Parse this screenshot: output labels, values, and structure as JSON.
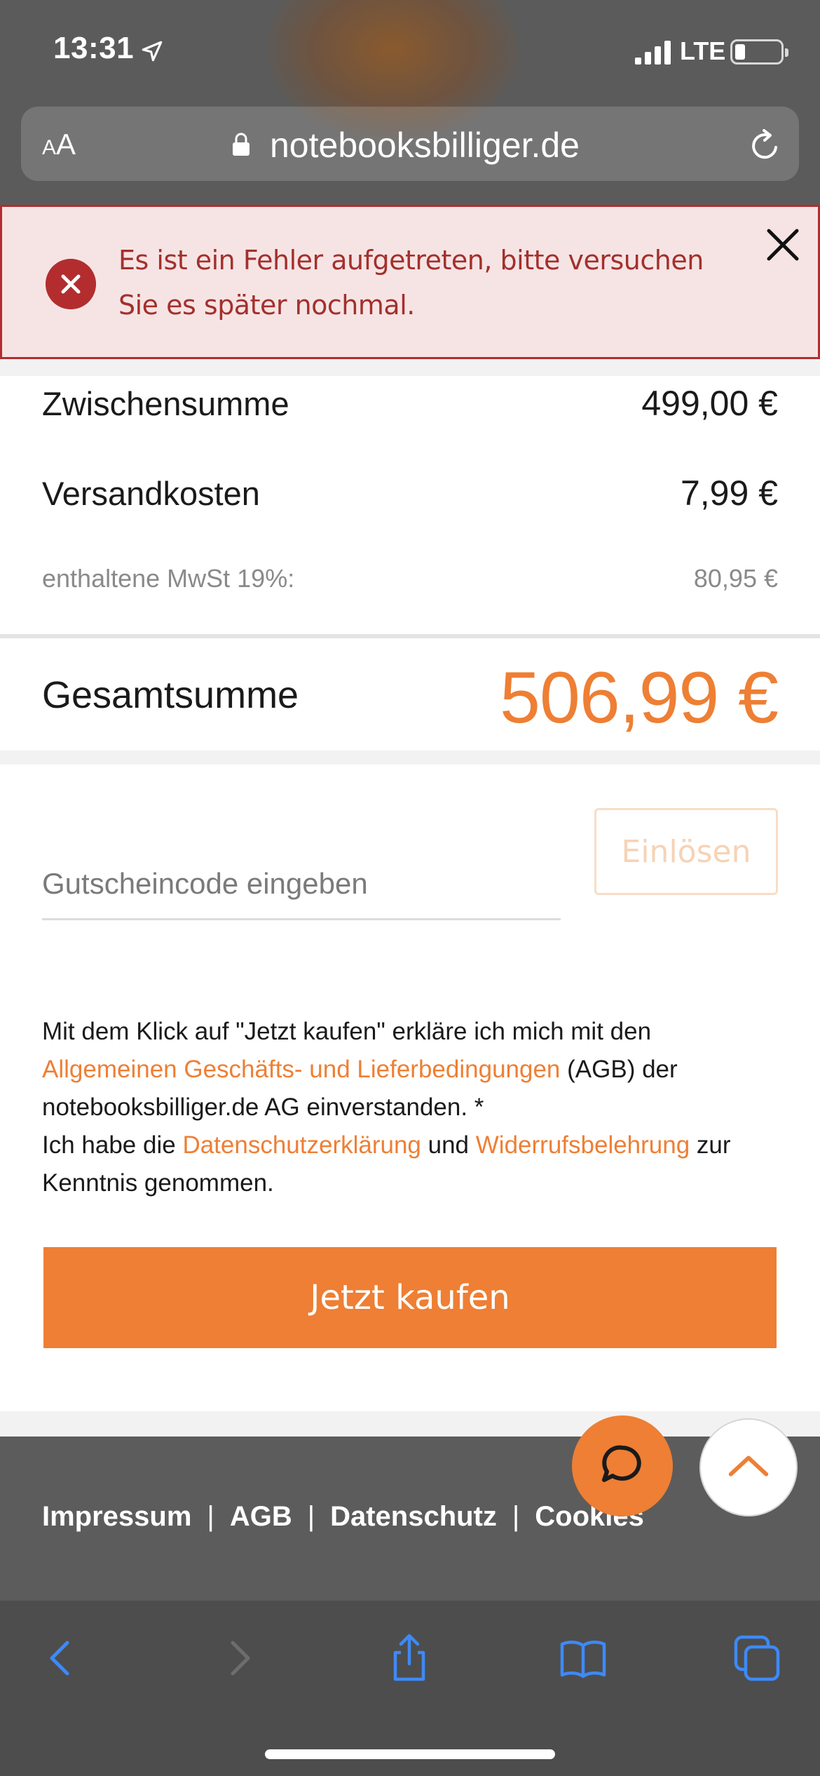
{
  "status_bar": {
    "time": "13:31",
    "network": "LTE",
    "location_icon": "location-arrow-icon",
    "signal_icon": "signal-bars-icon",
    "battery_icon": "battery-low-icon"
  },
  "browser": {
    "text_size_small": "A",
    "text_size_large": "A",
    "url": "notebooksbilliger.de",
    "lock_icon": "lock-icon",
    "reload_icon": "reload-icon"
  },
  "error_banner": {
    "message": "Es ist ein Fehler aufgetreten, bitte versuchen Sie es später nochmal.",
    "icon": "error-circle-x-icon",
    "close_icon": "close-icon"
  },
  "summary": {
    "subtotal_label": "Zwischensumme",
    "subtotal_value": "499,00 €",
    "shipping_label": "Versandkosten",
    "shipping_value": "7,99 €",
    "vat_label": "enthaltene MwSt 19%:",
    "vat_value": "80,95 €",
    "total_label": "Gesamtsumme",
    "total_value": "506,99 €"
  },
  "coupon": {
    "placeholder": "Gutscheincode eingeben",
    "redeem_label": "Einlösen"
  },
  "legal": {
    "part1": "Mit dem Klick auf \"Jetzt kaufen\" erkläre ich mich mit den",
    "agb_link": "Allgemeinen Geschäfts- und Lieferbedingungen",
    "part2": " (AGB) der notebooksbilliger.de AG einverstanden. *",
    "part3": "Ich habe die ",
    "privacy_link": "Datenschutzerklärung",
    "part4": " und ",
    "withdrawal_link": "Widerrufsbelehrung",
    "part5": " zur Kenntnis genommen."
  },
  "buy_button": {
    "label": "Jetzt kaufen"
  },
  "footer": {
    "links": [
      "Impressum",
      "AGB",
      "Datenschutz",
      "Cookies"
    ],
    "separator": "|",
    "chat_icon": "chat-bubble-icon",
    "scroll_top_icon": "chevron-up-icon"
  },
  "toolbar": {
    "icons": [
      "back-icon",
      "forward-icon",
      "share-icon",
      "bookmarks-icon",
      "tabs-icon"
    ]
  },
  "colors": {
    "accent": "#ee7f34",
    "error": "#b32d2e",
    "error_bg": "#f6e4e5",
    "ios_blue": "#3d8af7"
  }
}
